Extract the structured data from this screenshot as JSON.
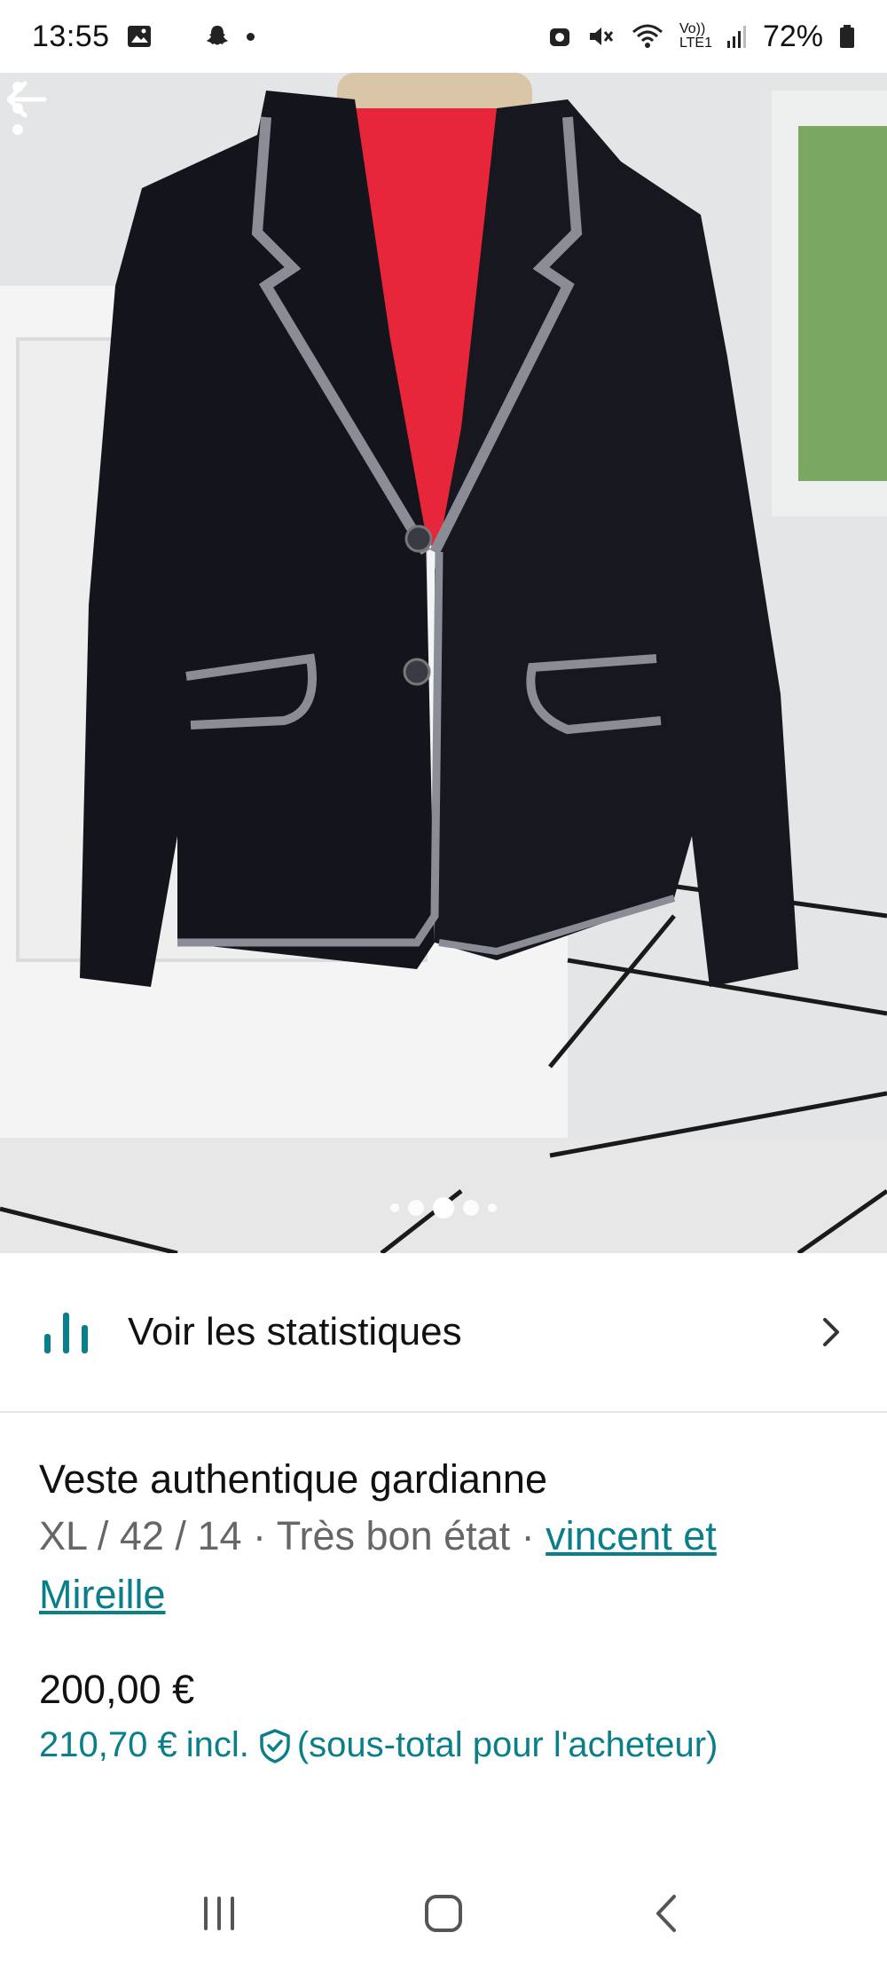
{
  "status_bar": {
    "time": "13:55",
    "battery": "72%",
    "network": "Vo)) LTE1"
  },
  "photo": {
    "description_icons": [
      "back-arrow-icon",
      "more-vert-icon"
    ],
    "carousel": {
      "count": 5,
      "active_index": 2
    }
  },
  "stats": {
    "label": "Voir les statistiques"
  },
  "item": {
    "title": "Veste authentique gardianne",
    "size": "XL / 42 / 14",
    "separator": " · ",
    "condition": "Très bon état",
    "brand": "vincent et Mireille",
    "price": "200,00 €",
    "buyer_price": "210,70 €",
    "incl": "incl.",
    "buyer_note": "(sous-total pour l'acheteur)"
  },
  "colors": {
    "accent": "#0a7f89",
    "lining": "#e8263a",
    "jacket": "#14141c"
  }
}
